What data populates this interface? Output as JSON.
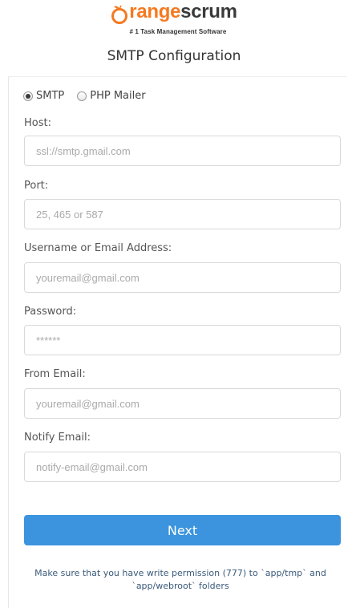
{
  "logo": {
    "brand_part1": "range",
    "brand_part2": "scrum",
    "tagline": "# 1 Task Management Software",
    "colors": {
      "orange": "#f47a20",
      "dark": "#3a3a3a"
    }
  },
  "page_title": "SMTP Configuration",
  "mailer": {
    "options": [
      {
        "label": "SMTP",
        "checked": true
      },
      {
        "label": "PHP Mailer",
        "checked": false
      }
    ]
  },
  "fields": {
    "host": {
      "label": "Host:",
      "placeholder": "ssl://smtp.gmail.com",
      "value": ""
    },
    "port": {
      "label": "Port:",
      "placeholder": "25, 465 or 587",
      "value": ""
    },
    "username": {
      "label": "Username or Email Address:",
      "placeholder": "youremail@gmail.com",
      "value": ""
    },
    "password": {
      "label": "Password:",
      "placeholder": "******",
      "value": ""
    },
    "from_email": {
      "label": "From Email:",
      "placeholder": "youremail@gmail.com",
      "value": ""
    },
    "notify_email": {
      "label": "Notify Email:",
      "placeholder": "notify-email@gmail.com",
      "value": ""
    }
  },
  "next_button": {
    "label": "Next",
    "color": "#3b94dd"
  },
  "note": {
    "line1": "Make sure that you have write permission (777) to `app/tmp` and",
    "line2": "`app/webroot` folders"
  }
}
